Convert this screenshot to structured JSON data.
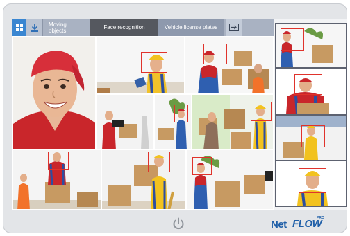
{
  "toolbar": {
    "tabs": [
      {
        "label": "Moving objects"
      },
      {
        "label": "Face recognition"
      },
      {
        "label": "Vehicle license plates"
      }
    ]
  },
  "icons": {
    "grid": "grid-icon",
    "download": "download-icon",
    "exit": "exit-icon",
    "power": "power-icon"
  },
  "brand": {
    "net": "Net",
    "flow": "FLOW",
    "pro": "PRO"
  },
  "colors": {
    "accent": "#3a86d1",
    "detection_box": "#e0332c",
    "brand": "#1f5fa8"
  }
}
